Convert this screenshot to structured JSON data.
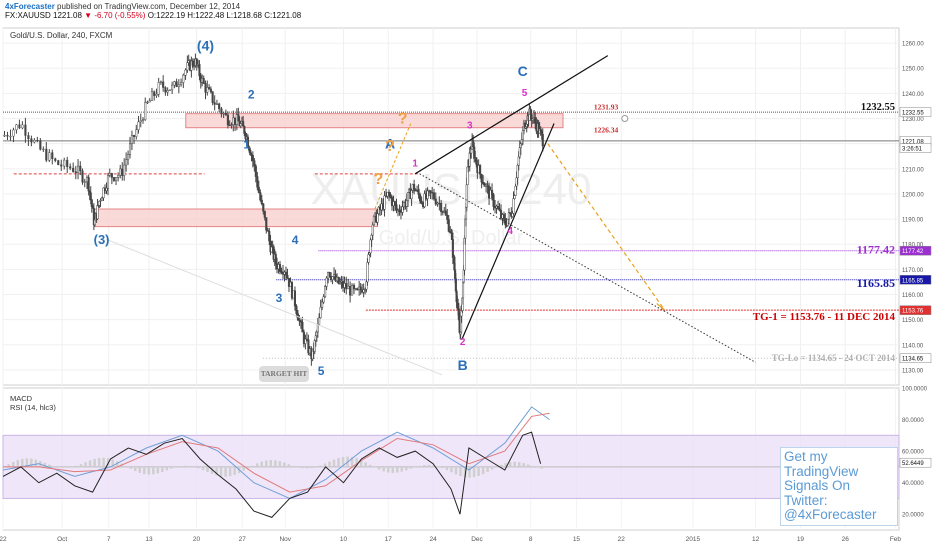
{
  "header": {
    "publisher": "4xForecaster",
    "published_on": "published on TradingView.com, December 12, 2014",
    "quote_prefix": "FX:XAUUSD 1221.08",
    "quote_change": "▼ -6.70 (-0.55%)",
    "quote_ohlc": "O:1222.19 H:1222.48 L:1218.68 C:1221.08",
    "symbol_line": "Gold/U.S. Dollar, 240, FXCM",
    "watermark_main": "XAUUSD, 240",
    "watermark_sub": "Gold/U.S. Dollar"
  },
  "promo": {
    "line1": "Get my TradingView",
    "line2": "Signals On Twitter:",
    "line3": "@4xForecaster"
  },
  "target_hit": "TARGET HIT",
  "colors": {
    "candle": "#444444",
    "zone_fill": "#f9d0d0",
    "zone_stroke": "#e58585",
    "wave_blue": "#2c6fb7",
    "wave_magenta": "#d633c8",
    "question_orange": "#f0a040",
    "arrow_orange": "#e8a020",
    "tg_red": "#cc0000",
    "level_purple": "#9b30d0",
    "level_navy": "#1818a8",
    "macd_blue": "#6f9fd8",
    "macd_red": "#e07b7b",
    "rsi_band": "#e9dcf7"
  },
  "chart_data": [
    {
      "type": "candlestick",
      "title": "Gold/U.S. Dollar, 240, FXCM",
      "ylim": [
        1124,
        1266
      ],
      "y_ticks": [
        1260.0,
        1250.0,
        1240.0,
        1230.0,
        1220.0,
        1210.0,
        1200.0,
        1190.0,
        1180.0,
        1170.0,
        1160.0,
        1150.0,
        1140.0,
        1130.0
      ],
      "x_ticks": [
        "22",
        "Oct",
        "7",
        "13",
        "20",
        "27",
        "Nov",
        "10",
        "17",
        "24",
        "Dec",
        "8",
        "15",
        "22",
        "2015",
        "12",
        "19",
        "26",
        "Feb"
      ],
      "x_tick_pos": [
        0.0,
        0.066,
        0.118,
        0.163,
        0.216,
        0.267,
        0.315,
        0.38,
        0.43,
        0.48,
        0.529,
        0.589,
        0.64,
        0.69,
        0.77,
        0.84,
        0.89,
        0.94,
        0.996
      ],
      "price_path": [
        [
          0.0,
          1223
        ],
        [
          0.02,
          1228
        ],
        [
          0.04,
          1218
        ],
        [
          0.06,
          1212
        ],
        [
          0.08,
          1210
        ],
        [
          0.095,
          1205
        ],
        [
          0.102,
          1188
        ],
        [
          0.108,
          1198
        ],
        [
          0.118,
          1207
        ],
        [
          0.132,
          1208
        ],
        [
          0.145,
          1222
        ],
        [
          0.16,
          1235
        ],
        [
          0.175,
          1243
        ],
        [
          0.19,
          1242
        ],
        [
          0.205,
          1250
        ],
        [
          0.214,
          1253
        ],
        [
          0.223,
          1244
        ],
        [
          0.235,
          1237
        ],
        [
          0.25,
          1230
        ],
        [
          0.262,
          1229
        ],
        [
          0.27,
          1225
        ],
        [
          0.278,
          1215
        ],
        [
          0.288,
          1196
        ],
        [
          0.298,
          1180
        ],
        [
          0.305,
          1172
        ],
        [
          0.315,
          1170
        ],
        [
          0.325,
          1158
        ],
        [
          0.335,
          1143
        ],
        [
          0.345,
          1135
        ],
        [
          0.352,
          1148
        ],
        [
          0.362,
          1170
        ],
        [
          0.372,
          1165
        ],
        [
          0.382,
          1163
        ],
        [
          0.395,
          1160
        ],
        [
          0.405,
          1165
        ],
        [
          0.412,
          1188
        ],
        [
          0.42,
          1193
        ],
        [
          0.43,
          1200
        ],
        [
          0.44,
          1193
        ],
        [
          0.45,
          1197
        ],
        [
          0.458,
          1203
        ],
        [
          0.468,
          1197
        ],
        [
          0.478,
          1200
        ],
        [
          0.49,
          1195
        ],
        [
          0.5,
          1185
        ],
        [
          0.505,
          1165
        ],
        [
          0.51,
          1143
        ],
        [
          0.513,
          1160
        ],
        [
          0.518,
          1208
        ],
        [
          0.523,
          1220
        ],
        [
          0.53,
          1210
        ],
        [
          0.54,
          1202
        ],
        [
          0.55,
          1195
        ],
        [
          0.56,
          1188
        ],
        [
          0.568,
          1193
        ],
        [
          0.575,
          1213
        ],
        [
          0.582,
          1228
        ],
        [
          0.588,
          1232
        ],
        [
          0.596,
          1227
        ],
        [
          0.603,
          1221
        ]
      ],
      "resistance_level": 1232.55,
      "current_price": 1221.08,
      "zone_high": 1231.93,
      "zone_low": 1226.34,
      "zone_prices": [
        "1231.93",
        "1226.34"
      ],
      "lower_zone": [
        1187,
        1194
      ],
      "tg_lo_level": 1134.65,
      "levels": [
        {
          "label": "1177.42",
          "value": 1177.42
        },
        {
          "label": "1165.85",
          "value": 1165.85
        },
        {
          "label": "TG-1 = 1153.76 - 11 DEC 2014",
          "value": 1153.76
        },
        {
          "label": "TG-Lo = 1134.65 - 24 OCT 2014",
          "value": 1134.65
        }
      ],
      "axis_badges": [
        "1232.55",
        "1221.08",
        "3:26:51",
        "1177.42",
        "1165.85",
        "1153.76",
        "1134.65"
      ],
      "level_1232_label": "1232.55",
      "wave_labels_blue": [
        "(4)",
        "2",
        "1",
        "(3)",
        "4",
        "3",
        "5",
        "A",
        "B",
        "C"
      ],
      "wave_labels_magenta": [
        "1",
        "3",
        "5",
        "4",
        "2"
      ],
      "question_marks": [
        "?",
        "?",
        "?"
      ]
    },
    {
      "type": "line",
      "title": "MACD / RSI (14, hlc3)",
      "series": [
        {
          "name": "MACD"
        },
        {
          "name": "RSI (14, hlc3)"
        }
      ],
      "ylim": [
        10,
        100
      ],
      "y_ticks": [
        100.0,
        80.0,
        60.0,
        40.0,
        20.0
      ],
      "y_tick_labels": [
        "100.0000",
        "80.0000",
        "60.0000",
        "40.0000",
        "20.0000"
      ],
      "rsi_band": [
        30,
        70
      ],
      "current_rsi": "52.6449",
      "rsi_path": [
        [
          0.0,
          44
        ],
        [
          0.02,
          50
        ],
        [
          0.04,
          40
        ],
        [
          0.06,
          46
        ],
        [
          0.08,
          38
        ],
        [
          0.1,
          34
        ],
        [
          0.12,
          55
        ],
        [
          0.14,
          62
        ],
        [
          0.16,
          58
        ],
        [
          0.18,
          65
        ],
        [
          0.2,
          68
        ],
        [
          0.22,
          55
        ],
        [
          0.24,
          45
        ],
        [
          0.26,
          36
        ],
        [
          0.28,
          22
        ],
        [
          0.3,
          18
        ],
        [
          0.32,
          30
        ],
        [
          0.34,
          34
        ],
        [
          0.36,
          50
        ],
        [
          0.38,
          40
        ],
        [
          0.4,
          55
        ],
        [
          0.42,
          62
        ],
        [
          0.44,
          56
        ],
        [
          0.46,
          60
        ],
        [
          0.48,
          52
        ],
        [
          0.5,
          36
        ],
        [
          0.51,
          20
        ],
        [
          0.52,
          62
        ],
        [
          0.54,
          55
        ],
        [
          0.56,
          48
        ],
        [
          0.58,
          70
        ],
        [
          0.59,
          72
        ],
        [
          0.6,
          52
        ]
      ],
      "macd_path": [
        [
          0.0,
          48
        ],
        [
          0.04,
          52
        ],
        [
          0.08,
          44
        ],
        [
          0.12,
          50
        ],
        [
          0.16,
          62
        ],
        [
          0.2,
          70
        ],
        [
          0.24,
          60
        ],
        [
          0.28,
          40
        ],
        [
          0.32,
          30
        ],
        [
          0.36,
          42
        ],
        [
          0.4,
          60
        ],
        [
          0.44,
          72
        ],
        [
          0.48,
          62
        ],
        [
          0.52,
          48
        ],
        [
          0.56,
          65
        ],
        [
          0.59,
          88
        ],
        [
          0.61,
          80
        ]
      ],
      "signal_path": [
        [
          0.0,
          50
        ],
        [
          0.04,
          50
        ],
        [
          0.08,
          47
        ],
        [
          0.12,
          48
        ],
        [
          0.16,
          58
        ],
        [
          0.2,
          66
        ],
        [
          0.24,
          62
        ],
        [
          0.28,
          46
        ],
        [
          0.32,
          34
        ],
        [
          0.36,
          38
        ],
        [
          0.4,
          54
        ],
        [
          0.44,
          68
        ],
        [
          0.48,
          64
        ],
        [
          0.52,
          52
        ],
        [
          0.56,
          60
        ],
        [
          0.59,
          82
        ],
        [
          0.61,
          84
        ]
      ]
    }
  ]
}
